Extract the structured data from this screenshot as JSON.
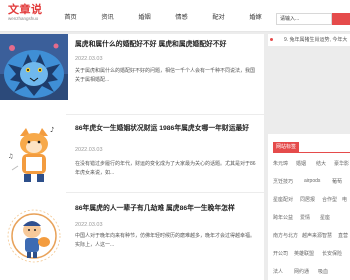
{
  "header": {
    "logo_main": "文章说",
    "logo_sub": "wenzhangshuo",
    "nav": [
      "首页",
      "资讯",
      "婚姻",
      "情感",
      "配对",
      "婚嫁"
    ],
    "search_placeholder": "请输入..."
  },
  "sidebar": {
    "notice": "9. 兔年属猪生肖运势, 今年大",
    "tags_title": "网站标签",
    "tags": [
      "朱元璋",
      "婚姻",
      "结大",
      "豪华影",
      "烹饪技巧",
      "airpods",
      "葡萄",
      "星座配对",
      "同居报",
      "合作型",
      "电",
      "跨年公益",
      "爱情",
      "星座",
      "南方与北方",
      "越声来源智慧",
      "直营",
      "开公司",
      "英雄联盟",
      "长安保险",
      "法人",
      "网约通",
      "吸血"
    ]
  },
  "articles": [
    {
      "title": "属虎和属什么的婚配好不好 属虎和属虎婚配好不好",
      "date": "2022.03.03",
      "summary": "关于属虎和属什么的婚配好不好的问题，相信一千个人会有一千种不同说法，我国关于属相婚配..."
    },
    {
      "title": "86年虎女一生婚姻状况财运 1986年属虎女哪一年财运最好",
      "date": "2022.03.03",
      "summary": "在没有错过步履行的年代，财运的变化成为了大家最为关心的话题。尤其是对于86年虎女来说，如..."
    },
    {
      "title": "86年属虎的人一辈子有几劫难 属虎86年一生晚年怎样",
      "date": "2022.03.03",
      "summary": "中国人对于晚年向来有种节，仿佛年轻时候历的磨难越多，晚年才会过得越幸福。实际上，人这一..."
    }
  ],
  "colors": {
    "accent": "#e54b4b",
    "text": "#333333",
    "background": "#ececec"
  }
}
